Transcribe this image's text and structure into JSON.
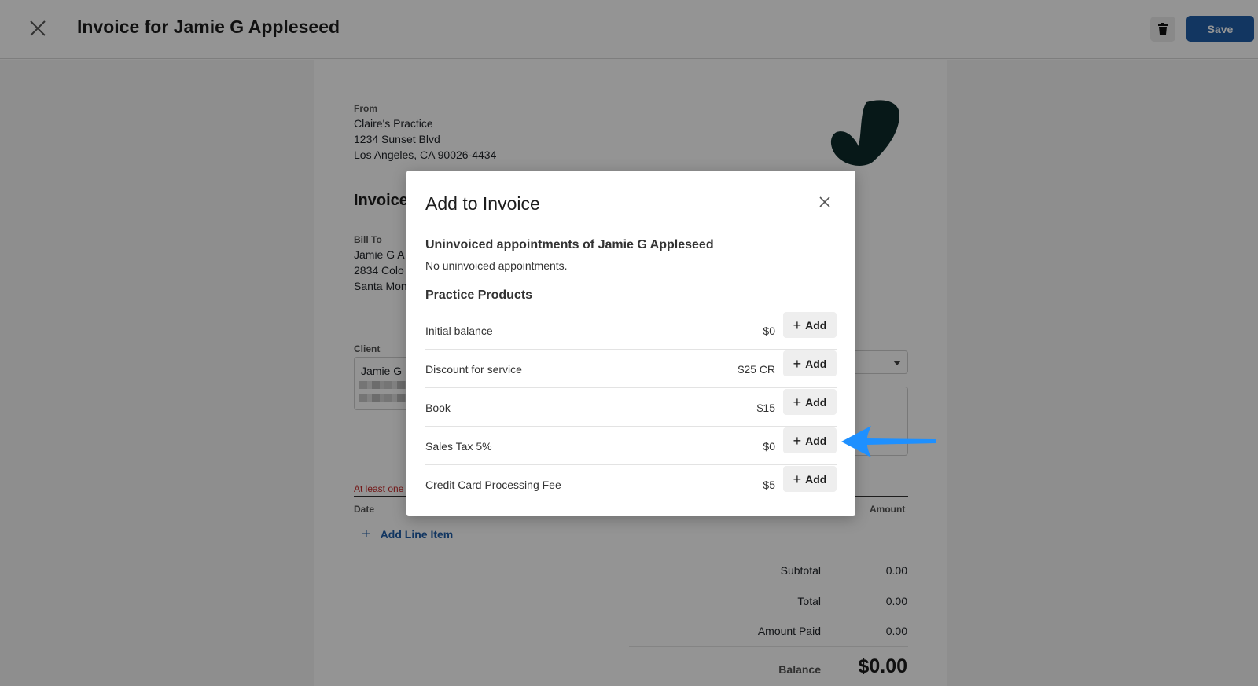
{
  "header": {
    "title": "Invoice for Jamie G Appleseed",
    "save_label": "Save"
  },
  "invoice": {
    "from_label": "From",
    "from_lines": [
      "Claire's Practice",
      "1234 Sunset Blvd",
      "Los Angeles, CA 90026-4434"
    ],
    "heading": "Invoice",
    "bill_to_label": "Bill To",
    "bill_to_lines": [
      "Jamie G A",
      "2834 Colo",
      "Santa Mon"
    ],
    "client_label": "Client",
    "client_name": "Jamie G .",
    "error_text": "At least one",
    "col_date": "Date",
    "col_amount": "Amount",
    "add_line_item": "Add Line Item",
    "subtotal_label": "Subtotal",
    "subtotal_value": "0.00",
    "total_label": "Total",
    "total_value": "0.00",
    "amount_paid_label": "Amount Paid",
    "amount_paid_value": "0.00",
    "balance_label": "Balance",
    "balance_value": "$0.00"
  },
  "modal": {
    "title": "Add to Invoice",
    "uninvoiced_title": "Uninvoiced appointments of Jamie G Appleseed",
    "uninvoiced_note": "No uninvoiced appointments.",
    "products_title": "Practice Products",
    "add_label": "Add",
    "products": [
      {
        "name": "Initial balance",
        "price": "$0"
      },
      {
        "name": "Discount for service",
        "price": "$25 CR"
      },
      {
        "name": "Book",
        "price": "$15"
      },
      {
        "name": "Sales Tax 5%",
        "price": "$0"
      },
      {
        "name": "Credit Card Processing Fee",
        "price": "$5"
      }
    ]
  },
  "colors": {
    "primary": "#1f5ea8",
    "arrow": "#1e90ff",
    "logo": "#0d2a2a",
    "error": "#c62828"
  }
}
